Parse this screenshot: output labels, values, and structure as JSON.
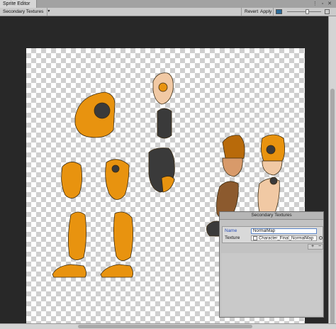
{
  "window": {
    "tab_title": "Sprite Editor",
    "controls": "⋮ ▫ ✕"
  },
  "toolbar": {
    "dropdown_value": "Secondary Textures",
    "revert_label": "Revert",
    "apply_label": "Apply"
  },
  "panel": {
    "title": "Secondary Textures",
    "name_label": "Name",
    "name_value": "NormalMap",
    "texture_label": "Texture",
    "texture_value": "Character_Final_NormalMap",
    "add_label": "+",
    "remove_label": "−"
  },
  "colors": {
    "accent_orange": "#e8930f",
    "dark_orange": "#b86a0a",
    "skin": "#f1c9a4",
    "dark_gray": "#3a3a3a",
    "brown": "#8c5a2e"
  },
  "icons": [
    "dropdown-arrow-icon",
    "color-channel-icon",
    "zoom-slider",
    "mip-icon",
    "object-picker-icon"
  ]
}
